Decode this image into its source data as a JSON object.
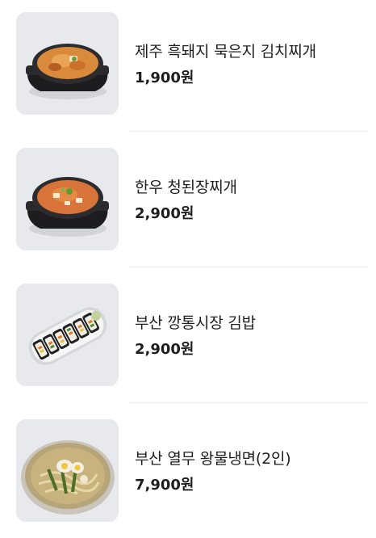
{
  "menu": {
    "items": [
      {
        "name": "제주 흑돼지 묵은지 김치찌개",
        "price": "1,900원",
        "image": "kimchi-stew-bowl"
      },
      {
        "name": "한우 청된장찌개",
        "price": "2,900원",
        "image": "doenjang-stew-bowl"
      },
      {
        "name": "부산 깡통시장 김밥",
        "price": "2,900원",
        "image": "gimbap-plate"
      },
      {
        "name": "부산 열무 왕물냉면(2인)",
        "price": "7,900원",
        "image": "cold-noodle-bowl"
      }
    ]
  }
}
